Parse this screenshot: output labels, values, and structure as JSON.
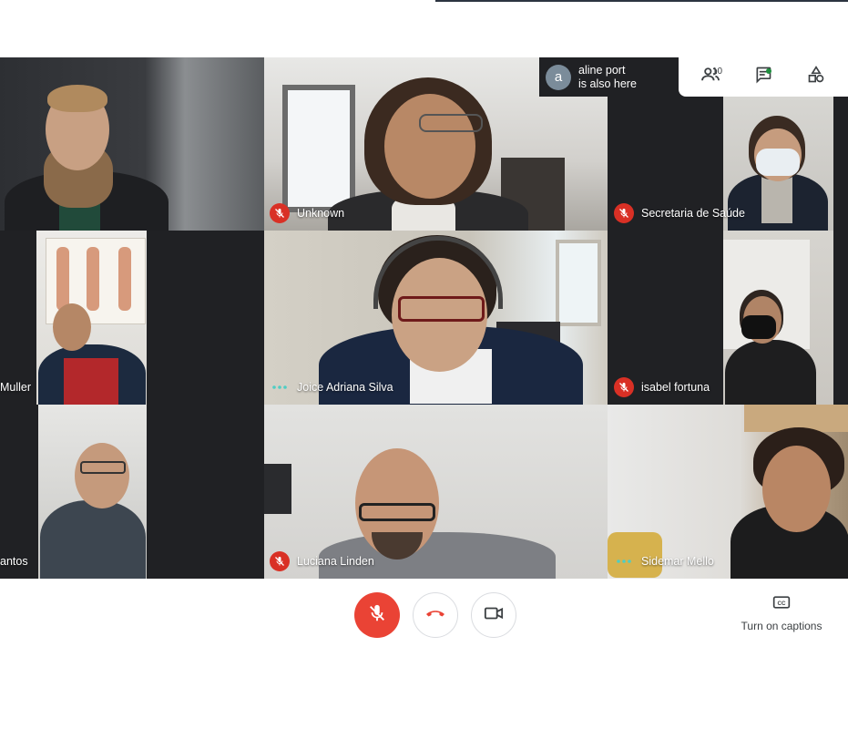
{
  "notice": {
    "avatar_letter": "a",
    "line1": "aline port",
    "line2": "is also here"
  },
  "toolbar": {
    "participants_count": "10",
    "participants_icon": "people-icon",
    "chat_icon": "chat-icon",
    "activities_icon": "shapes-icon"
  },
  "tiles": [
    {
      "name": "",
      "muted": false,
      "speaking": false
    },
    {
      "name": "Unknown",
      "muted": true,
      "speaking": false
    },
    {
      "name": "Secretaria de Saúde",
      "muted": true,
      "speaking": false
    },
    {
      "name": "Muller",
      "muted": false,
      "speaking": false
    },
    {
      "name": "Joice Adriana Silva",
      "muted": false,
      "speaking": true
    },
    {
      "name": "isabel fortuna",
      "muted": true,
      "speaking": false
    },
    {
      "name": "antos",
      "muted": false,
      "speaking": false
    },
    {
      "name": "Luciana Linden",
      "muted": true,
      "speaking": false
    },
    {
      "name": "Sidemar Mello",
      "muted": false,
      "speaking": true
    }
  ],
  "controls": {
    "mic_icon": "mic-off-icon",
    "hangup_icon": "phone-hangup-icon",
    "camera_icon": "video-camera-icon",
    "captions_icon": "cc-icon",
    "captions_label": "Turn on captions"
  },
  "colors": {
    "muted_red": "#d93025",
    "control_red": "#ea4335",
    "speaking_teal": "#8ab4f8",
    "grid_bg": "#202124"
  }
}
